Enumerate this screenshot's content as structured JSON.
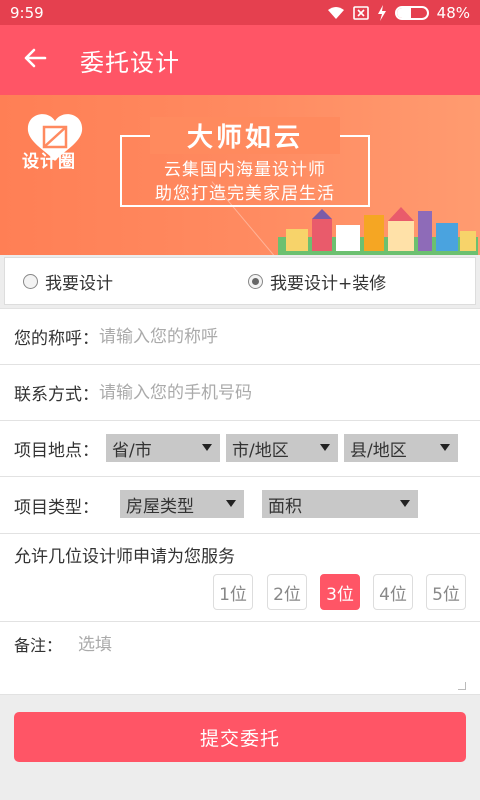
{
  "status_bar": {
    "time": "9:59",
    "battery_percent": "48%",
    "battery_level": 0.48,
    "icons": [
      "wifi-icon",
      "sim-off-icon",
      "charging-icon",
      "battery-icon"
    ]
  },
  "header": {
    "title": "委托设计",
    "back_icon": "arrow-left-icon",
    "color": "#ff5566"
  },
  "banner": {
    "logo_text": "设计圈",
    "slogan_title": "大师如云",
    "slogan_line1": "云集国内海量设计师",
    "slogan_line2": "助您打造完美家居生活"
  },
  "design_type": {
    "options": [
      "我要设计",
      "我要设计+装修"
    ],
    "selected_index": 1
  },
  "form": {
    "name_label": "您的称呼：",
    "name_placeholder": "请输入您的称呼",
    "phone_label": "联系方式：",
    "phone_placeholder": "请输入您的手机号码",
    "location_label": "项目地点：",
    "province": "省/市",
    "city": "市/地区",
    "county": "县/地区",
    "type_label": "项目类型：",
    "house_type": "房屋类型",
    "area": "面积",
    "designer_count_label": "允许几位设计师申请为您服务",
    "designer_counts": [
      "1位",
      "2位",
      "3位",
      "4位",
      "5位"
    ],
    "designer_count_selected_index": 2,
    "remark_label": "备注：",
    "remark_placeholder": "选填"
  },
  "submit_label": "提交委托",
  "colors": {
    "accent": "#ff5566",
    "status_bar": "#e5404f",
    "banner": "#ff8a60"
  }
}
